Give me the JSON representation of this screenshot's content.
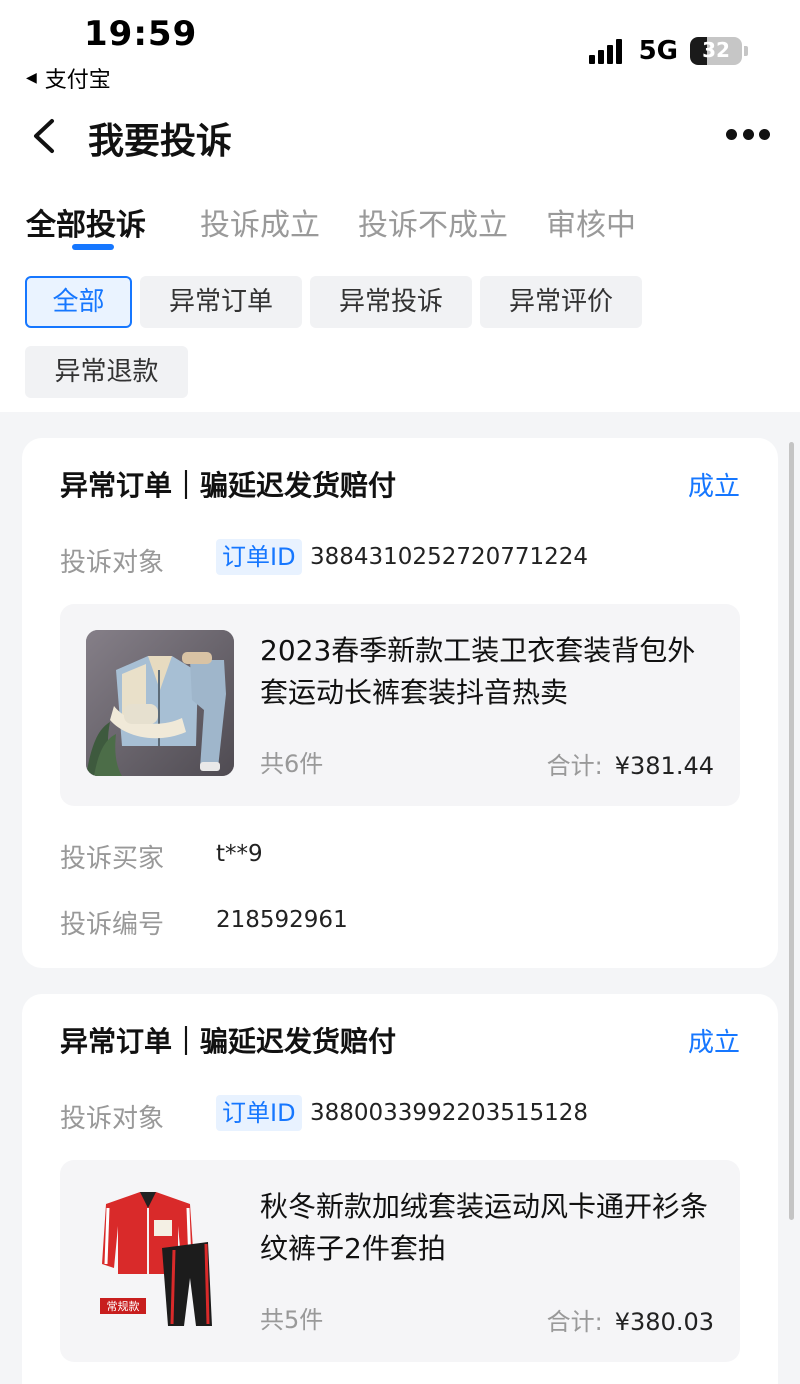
{
  "status_bar": {
    "time": "19:59",
    "back_app": "支付宝",
    "network": "5G",
    "battery": "32",
    "battery_level": 0.32
  },
  "header": {
    "title": "我要投诉"
  },
  "tabs": [
    {
      "label": "全部投诉",
      "active": true
    },
    {
      "label": "投诉成立",
      "active": false
    },
    {
      "label": "投诉不成立",
      "active": false
    },
    {
      "label": "审核中",
      "active": false
    }
  ],
  "filters": [
    {
      "label": "全部",
      "active": true
    },
    {
      "label": "异常订单",
      "active": false
    },
    {
      "label": "异常投诉",
      "active": false
    },
    {
      "label": "异常评价",
      "active": false
    },
    {
      "label": "异常退款",
      "active": false
    }
  ],
  "complaints": [
    {
      "title": "异常订单｜骗延迟发货赔付",
      "status": "成立",
      "target_label": "投诉对象",
      "order_tag": "订单ID",
      "order_id": "3884310252720771224",
      "product_name": "2023春季新款工装卫衣套装背包外套运动长裤套装抖音热卖",
      "count": "共6件",
      "total_label": "合计:",
      "total": "¥381.44",
      "buyer_label": "投诉买家",
      "buyer": "t**9",
      "number_label": "投诉编号",
      "number": "218592961"
    },
    {
      "title": "异常订单｜骗延迟发货赔付",
      "status": "成立",
      "target_label": "投诉对象",
      "order_tag": "订单ID",
      "order_id": "3880033992203515128",
      "product_name": "秋冬新款加绒套装运动风卡通开衫条纹裤子2件套拍",
      "count": "共5件",
      "total_label": "合计:",
      "total": "¥380.03",
      "thumb_badge": "常规款"
    }
  ],
  "colors": {
    "accent": "#1677ff",
    "page_bg": "#f4f5f7",
    "chip_bg": "#f1f2f4",
    "muted_text": "#999999"
  }
}
